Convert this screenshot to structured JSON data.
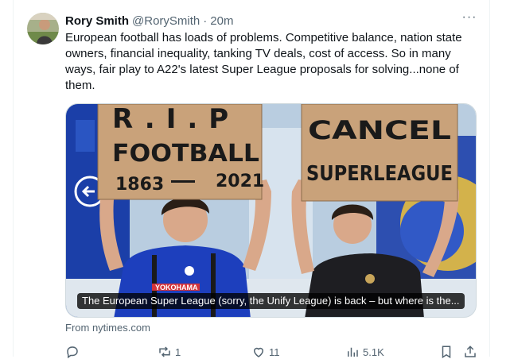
{
  "tweet": {
    "author_name": "Rory Smith",
    "handle": "@RorySmith",
    "separator": "·",
    "time": "20m",
    "more_label": "···",
    "text": "European football has loads of problems. Competitive balance, nation state owners, financial inequality, tanking TV deals, cost of access. So in many ways, fair play to A22's latest Super League proposals for solving...none of them."
  },
  "card": {
    "sign_left": [
      "R.I.P",
      "FOOTBALL",
      "1863",
      "2021"
    ],
    "sign_right": [
      "CANCEL",
      "SUPERLEAGUE"
    ],
    "shirt_sponsor": "YOKOHAMA",
    "headline": "The European Super League (sorry, the Unify League) is back – but where is the..."
  },
  "source": "From nytimes.com",
  "actions": {
    "reply": {
      "icon": "reply-icon",
      "count": ""
    },
    "repost": {
      "icon": "repost-icon",
      "count": "1"
    },
    "like": {
      "icon": "heart-icon",
      "count": "11"
    },
    "views": {
      "icon": "analytics-icon",
      "count": "5.1K"
    },
    "bookmark": {
      "icon": "bookmark-icon",
      "count": ""
    },
    "share": {
      "icon": "share-icon",
      "count": ""
    }
  },
  "colors": {
    "text": "#0f1419",
    "secondary": "#536471",
    "chelsea_blue": "#1b3fa8",
    "cardboard": "#c9a27a"
  }
}
